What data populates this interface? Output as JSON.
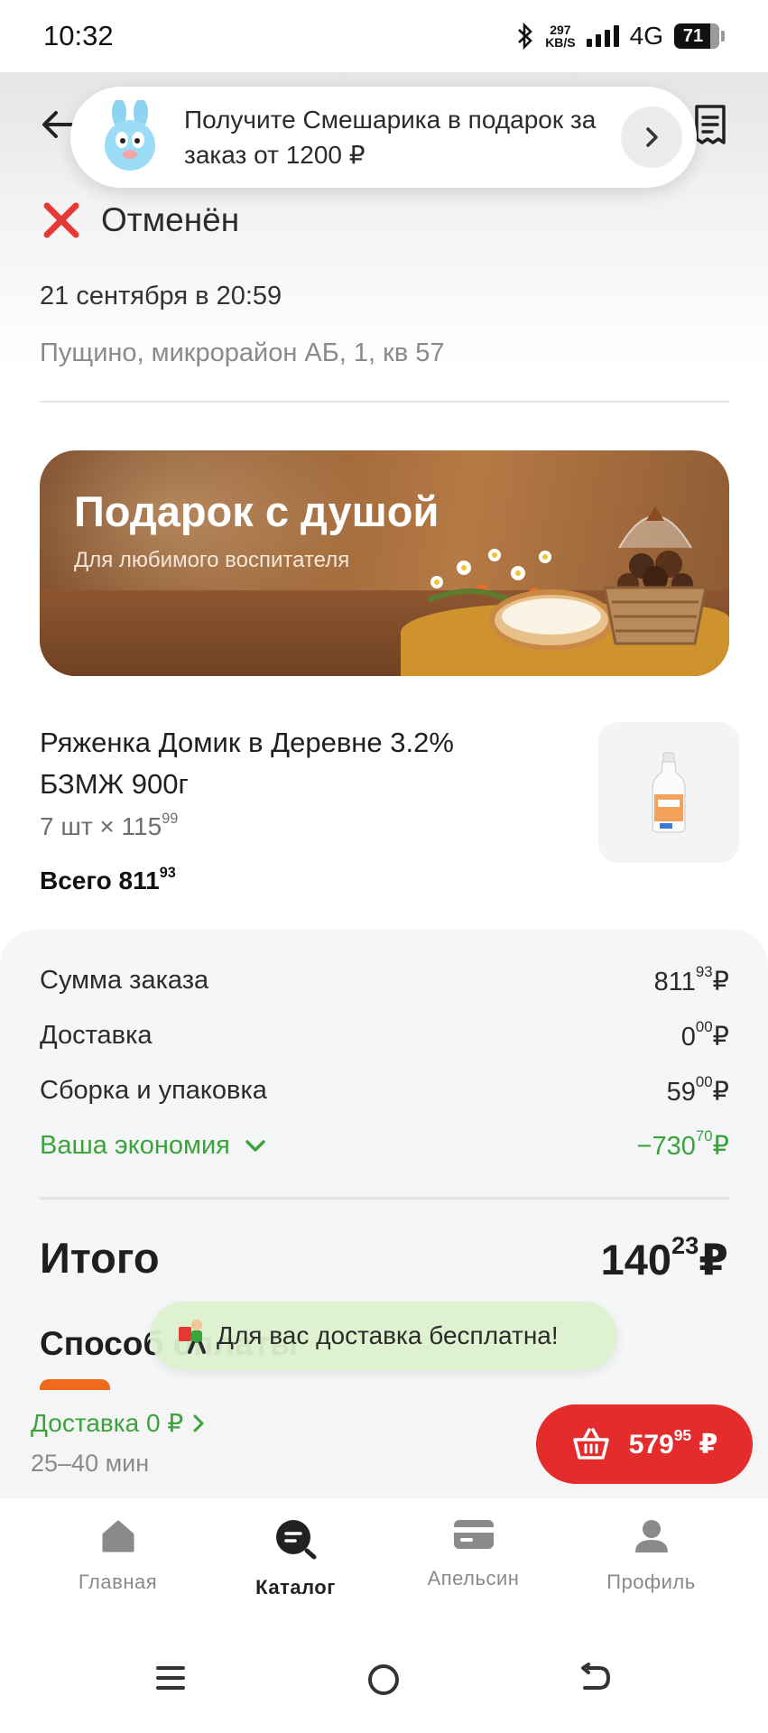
{
  "status_bar": {
    "time": "10:32",
    "net_speed_value": "297",
    "net_speed_unit": "KB/S",
    "network": "4G",
    "battery": "71"
  },
  "promo": {
    "text": "Получите Смешарика в подарок за заказ от 1200 ₽"
  },
  "order": {
    "status": "Отменён",
    "date": "21 сентября в 20:59",
    "address": "Пущино, микрорайон АБ, 1, кв 57"
  },
  "gift_banner": {
    "title": "Подарок с душой",
    "subtitle": "Для любимого воспитателя"
  },
  "product": {
    "name": "Ряженка Домик в Деревне 3.2% БЗМЖ 900г",
    "qty_prefix": "7 шт × 115",
    "qty_kopecks": "99",
    "total_prefix": "Всего 811",
    "total_kopecks": "93"
  },
  "summary": {
    "order_sum_label": "Сумма заказа",
    "order_sum_rub": "811",
    "order_sum_kop": "93",
    "delivery_label": "Доставка",
    "delivery_rub": "0",
    "delivery_kop": "00",
    "packing_label": "Сборка и упаковка",
    "packing_rub": "59",
    "packing_kop": "00",
    "savings_label": "Ваша экономия",
    "savings_rub": "−730",
    "savings_kop": "70",
    "currency": "₽",
    "total_label": "Итого",
    "total_rub": "140",
    "total_kop": "23",
    "payment_label": "Способ оплаты"
  },
  "toast": {
    "text": "Для вас доставка бесплатна!"
  },
  "delivery_bar": {
    "title": "Доставка 0 ₽",
    "eta": "25–40 мин",
    "cart_rub": "579",
    "cart_kop": "95",
    "currency": "₽"
  },
  "tabs": [
    {
      "label": "Главная",
      "icon": "home-icon",
      "active": false
    },
    {
      "label": "Каталог",
      "icon": "catalog-search-icon",
      "active": true
    },
    {
      "label": "Апельсин",
      "icon": "card-icon",
      "active": false
    },
    {
      "label": "Профиль",
      "icon": "profile-icon",
      "active": false
    }
  ],
  "colors": {
    "accent_green": "#3ca23c",
    "cart_red": "#e52c2c",
    "cancel_red": "#e53935"
  }
}
